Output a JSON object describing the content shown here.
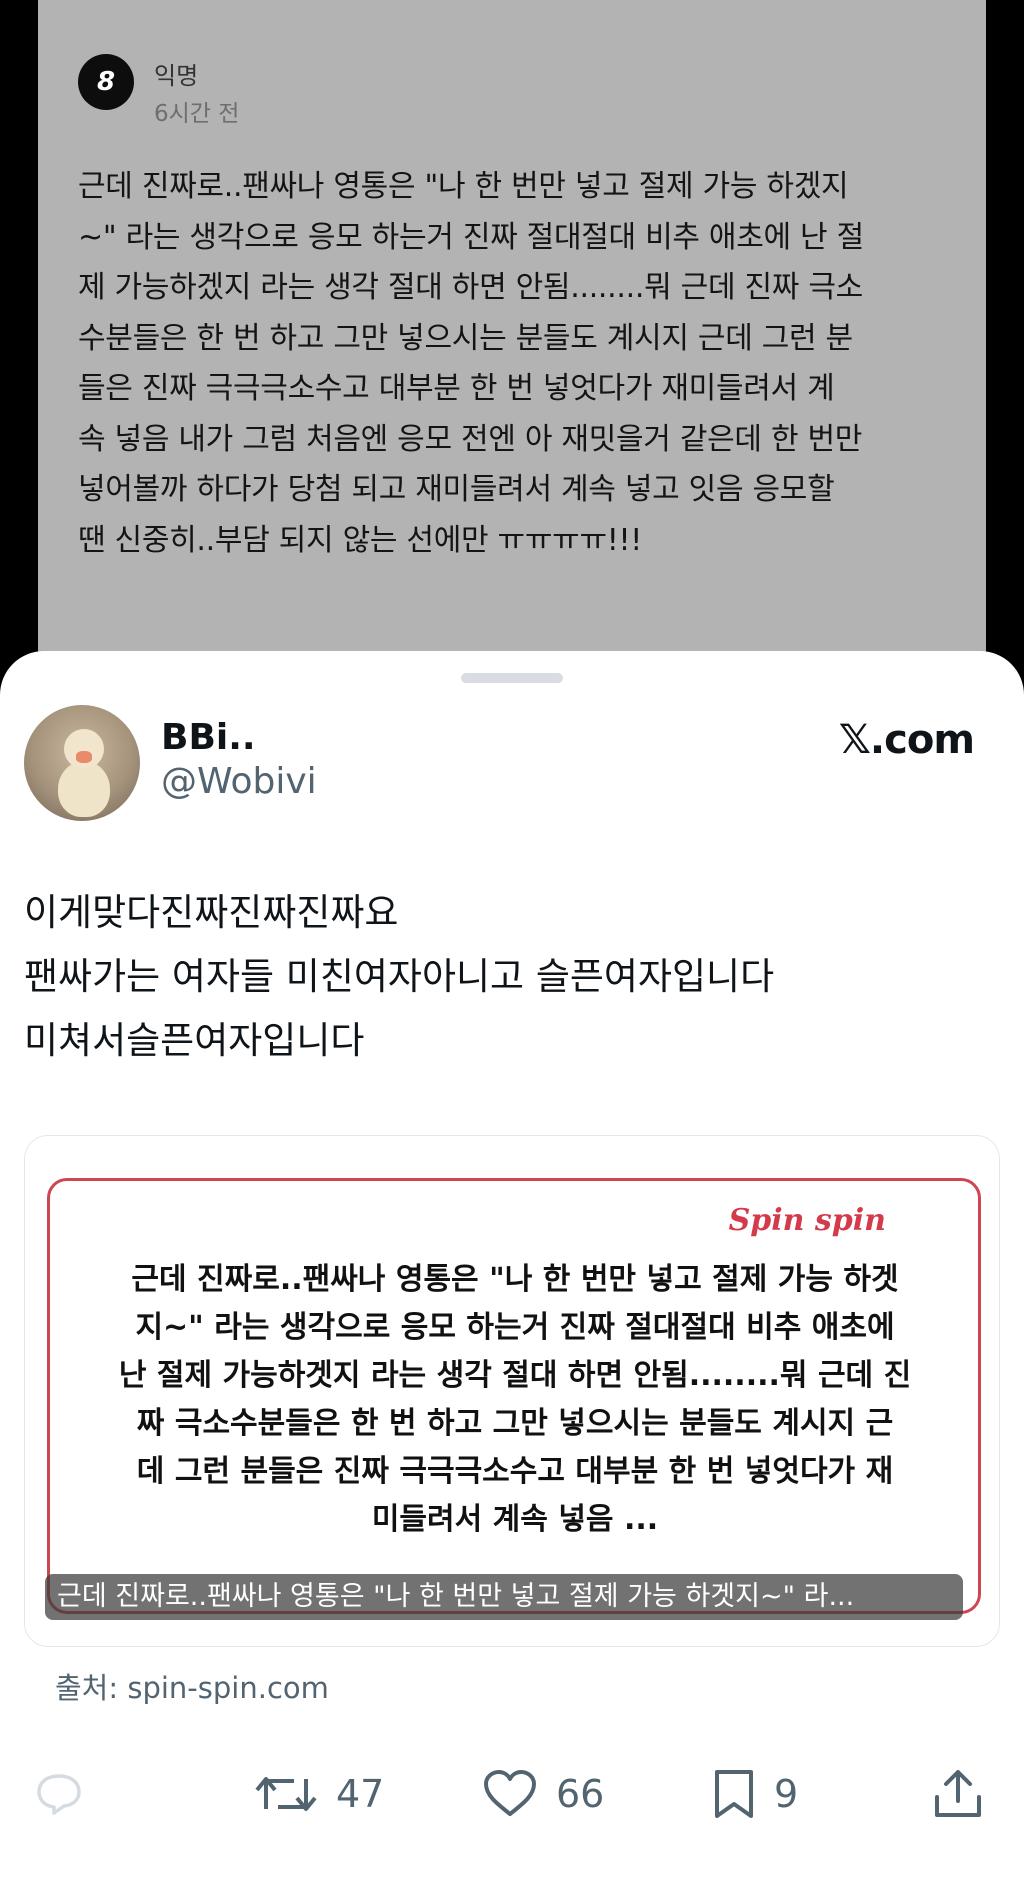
{
  "background_post": {
    "avatar_glyph": "8",
    "author": "익명",
    "time": "6시간 전",
    "body_lines": [
      "근데 진짜로..팬싸나 영통은 \"나 한 번만 넣고 절제 가능 하겠지",
      "~\" 라는 생각으로 응모 하는거 진짜 절대절대 비추 애초에 난 절",
      "제 가능하겠지 라는 생각 절대 하면 안됨........뭐 근데 진짜 극소",
      "수분들은 한 번 하고 그만 넣으시는 분들도 계시지 근데 그런 분",
      "들은 진짜 극극극소수고 대부분 한 번 넣엇다가 재미들려서 계",
      "속 넣음 내가 그럼 처음엔 응모 전엔 아 재밋을거 같은데 한 번만",
      "넣어볼까 하다가 당첨 되고 재미들려서 계속 넣고 잇음 응모할",
      "땐 신중히..부담 되지 않는 선에만 ㅠㅠㅠㅠ!!!"
    ]
  },
  "tweet": {
    "display_name": "BBi..",
    "handle": "@Wobivi",
    "brand": "𝕏.com",
    "text_lines": [
      "이게맞다진짜진짜진짜요",
      "팬싸가는 여자들 미친여자아니고 슬픈여자입니다",
      "미쳐서슬픈여자입니다"
    ],
    "link_card": {
      "logo": "Spin spin",
      "body_lines": [
        "근데 진짜로..팬싸나 영통은 \"나 한 번만 넣고 절제 가능 하겟",
        "지~\" 라는 생각으로 응모 하는거 진짜 절대절대 비추 애초에",
        "난 절제 가능하겟지 라는 생각 절대 하면 안됨........뭐 근데 진",
        "짜 극소수분들은 한 번 하고 그만 넣으시는 분들도 계시지 근",
        "데 그런 분들은 진짜 극극극소수고 대부분 한 번 넣엇다가 재",
        "미들려서 계속 넣음 ..."
      ],
      "caption": "근데 진짜로..팬싸나 영통은 \"나 한 번만 넣고 절제 가능 하겟지~\" 라..."
    },
    "source": "출처: spin-spin.com",
    "actions": {
      "retweets": "47",
      "likes": "66",
      "bookmarks": "9"
    }
  }
}
